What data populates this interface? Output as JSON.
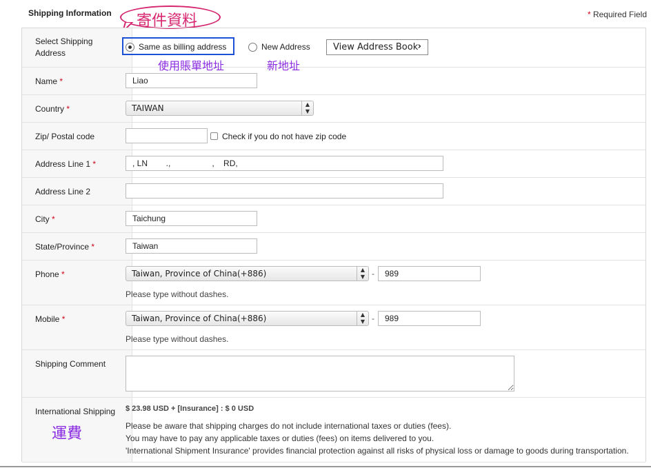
{
  "header": {
    "title": "Shipping Information",
    "required_star": "*",
    "required_label": "Required Field"
  },
  "callout": {
    "text": "寄件資料"
  },
  "address_select": {
    "label": "Select Shipping Address",
    "option_same": "Same as billing address",
    "option_new": "New Address",
    "view_book": "View Address Book",
    "note_same": "使用賬單地址",
    "note_new": "新地址"
  },
  "fields": {
    "name": {
      "label": "Name",
      "value": "Liao"
    },
    "country": {
      "label": "Country",
      "value": "TAIWAN"
    },
    "zip": {
      "label": "Zip/ Postal code",
      "value": "",
      "checkbox_label": "Check if you do not have zip code"
    },
    "address1": {
      "label": "Address Line 1",
      "value": ", LN        .,                  ,    RD,"
    },
    "address2": {
      "label": "Address Line 2",
      "value": ""
    },
    "city": {
      "label": "City",
      "value": "Taichung"
    },
    "state": {
      "label": "State/Province",
      "value": "Taiwan"
    },
    "phone": {
      "label": "Phone",
      "code": "Taiwan, Province of China(+886)",
      "dash": "-",
      "value": "989",
      "hint": "Please type without dashes."
    },
    "mobile": {
      "label": "Mobile",
      "code": "Taiwan, Province of China(+886)",
      "dash": "-",
      "value": "989",
      "hint": "Please type without dashes."
    },
    "comment": {
      "label": "Shipping Comment",
      "value": ""
    },
    "intl": {
      "label": "International Shipping",
      "fee": "$ 23.98 USD + [Insurance] : $ 0 USD",
      "note1": "Please be aware that shipping charges do not include international taxes or duties (fees).",
      "note2": "You may have to pay any applicable taxes or duties (fees) on items delivered to you.",
      "note3": "'International Shipment Insurance' provides financial protection against all risks of physical loss or damage to goods during transportation.",
      "cn_label": "運費"
    }
  },
  "required_mark": "*",
  "colors": {
    "callout": "#d6266f",
    "annotation": "#8a2be2",
    "highlight_box": "#1a4fd6",
    "required": "#d0021b"
  }
}
